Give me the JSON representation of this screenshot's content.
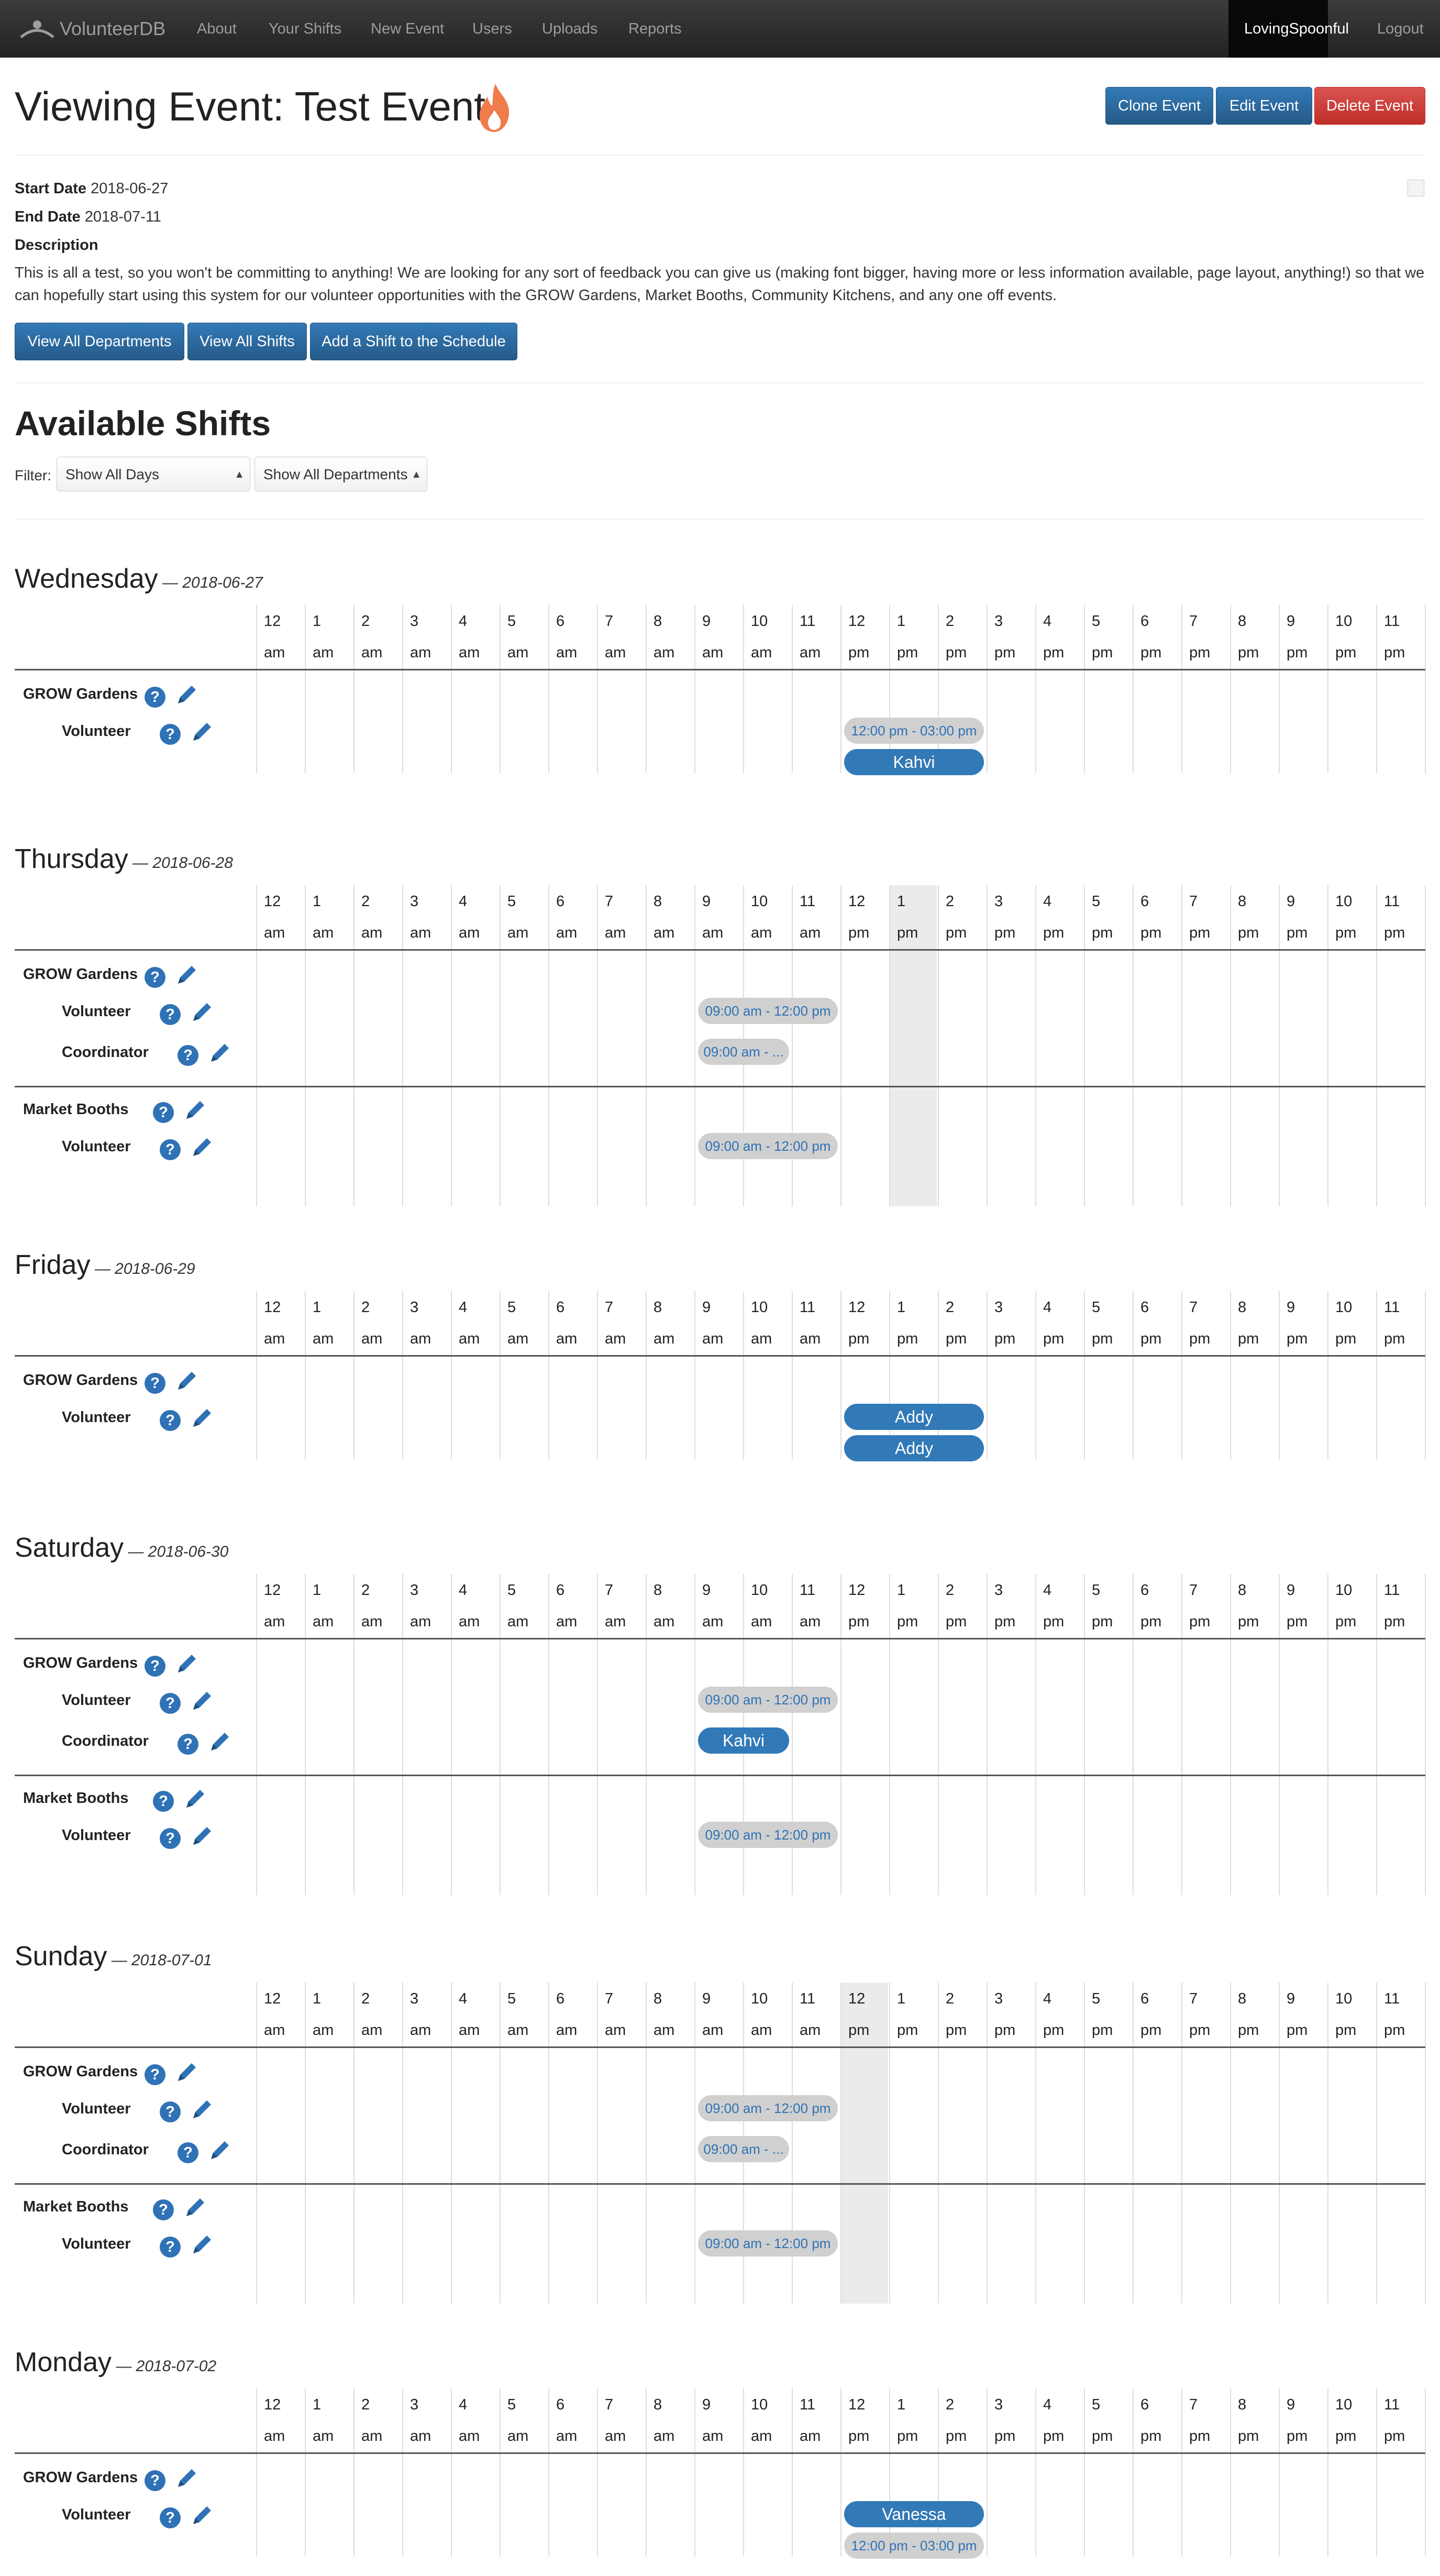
{
  "nav": {
    "brand": "VolunteerDB",
    "links": [
      "About",
      "Your Shifts",
      "New Event",
      "Users",
      "Uploads",
      "Reports"
    ],
    "user": "LovingSpoonful",
    "logout": "Logout"
  },
  "page_title": "Viewing Event: Test Event",
  "actions": {
    "clone": "Clone Event",
    "edit": "Edit Event",
    "delete": "Delete Event"
  },
  "event": {
    "start_label": "Start Date",
    "start_value": "2018-06-27",
    "end_label": "End Date",
    "end_value": "2018-07-11",
    "description_label": "Description",
    "description": "This is all a test, so you won't be committing to anything! We are looking for any sort of feedback you can give us (making font bigger, having more or less information available, page layout, anything!) so that we can hopefully start using this system for our volunteer opportunities with the GROW Gardens, Market Booths, Community Kitchens, and any one off events."
  },
  "event_buttons": {
    "departments": "View All Departments",
    "shifts": "View All Shifts",
    "add_shift": "Add a Shift to the Schedule"
  },
  "shifts_heading": "Available Shifts",
  "filter": {
    "label": "Filter:",
    "days": "Show All Days",
    "departments": "Show All Departments"
  },
  "hours": [
    [
      "12",
      "am"
    ],
    [
      "1",
      "am"
    ],
    [
      "2",
      "am"
    ],
    [
      "3",
      "am"
    ],
    [
      "4",
      "am"
    ],
    [
      "5",
      "am"
    ],
    [
      "6",
      "am"
    ],
    [
      "7",
      "am"
    ],
    [
      "8",
      "am"
    ],
    [
      "9",
      "am"
    ],
    [
      "10",
      "am"
    ],
    [
      "11",
      "am"
    ],
    [
      "12",
      "pm"
    ],
    [
      "1",
      "pm"
    ],
    [
      "2",
      "pm"
    ],
    [
      "3",
      "pm"
    ],
    [
      "4",
      "pm"
    ],
    [
      "5",
      "pm"
    ],
    [
      "6",
      "pm"
    ],
    [
      "7",
      "pm"
    ],
    [
      "8",
      "pm"
    ],
    [
      "9",
      "pm"
    ],
    [
      "10",
      "pm"
    ],
    [
      "11",
      "pm"
    ]
  ],
  "colors": {
    "primary": "#337ab7",
    "danger": "#d9534f",
    "navbar": "#222222",
    "shift_open": "#d0d0d0"
  },
  "days": [
    {
      "name": "Wednesday",
      "date": "— 2018-06-27",
      "highlight": null,
      "departments": [
        {
          "name": "GROW Gardens",
          "roles": [
            {
              "name": "Volunteer",
              "shifts": [
                {
                  "label": "12:00 pm - 03:00 pm",
                  "start": 12,
                  "end": 15,
                  "taken": false
                },
                {
                  "label": "Kahvi",
                  "start": 12,
                  "end": 15,
                  "taken": true
                }
              ]
            }
          ]
        }
      ]
    },
    {
      "name": "Thursday",
      "date": "— 2018-06-28",
      "highlight": 13,
      "departments": [
        {
          "name": "GROW Gardens",
          "roles": [
            {
              "name": "Volunteer",
              "shifts": [
                {
                  "label": "09:00 am - 12:00 pm",
                  "start": 9,
                  "end": 12,
                  "taken": false
                }
              ]
            },
            {
              "name": "Coordinator",
              "shifts": [
                {
                  "label": "09:00 am - ...",
                  "start": 9,
                  "end": 11,
                  "taken": false
                }
              ]
            }
          ]
        },
        {
          "name": "Market Booths",
          "roles": [
            {
              "name": "Volunteer",
              "shifts": [
                {
                  "label": "09:00 am - 12:00 pm",
                  "start": 9,
                  "end": 12,
                  "taken": false
                }
              ]
            }
          ]
        }
      ]
    },
    {
      "name": "Friday",
      "date": "— 2018-06-29",
      "highlight": null,
      "departments": [
        {
          "name": "GROW Gardens",
          "roles": [
            {
              "name": "Volunteer",
              "shifts": [
                {
                  "label": "Addy",
                  "start": 12,
                  "end": 15,
                  "taken": true
                },
                {
                  "label": "Addy",
                  "start": 12,
                  "end": 15,
                  "taken": true
                }
              ]
            }
          ]
        }
      ]
    },
    {
      "name": "Saturday",
      "date": "— 2018-06-30",
      "highlight": null,
      "departments": [
        {
          "name": "GROW Gardens",
          "roles": [
            {
              "name": "Volunteer",
              "shifts": [
                {
                  "label": "09:00 am - 12:00 pm",
                  "start": 9,
                  "end": 12,
                  "taken": false
                }
              ]
            },
            {
              "name": "Coordinator",
              "shifts": [
                {
                  "label": "Kahvi",
                  "start": 9,
                  "end": 11,
                  "taken": true
                }
              ]
            }
          ]
        },
        {
          "name": "Market Booths",
          "roles": [
            {
              "name": "Volunteer",
              "shifts": [
                {
                  "label": "09:00 am - 12:00 pm",
                  "start": 9,
                  "end": 12,
                  "taken": false
                }
              ]
            }
          ]
        }
      ]
    },
    {
      "name": "Sunday",
      "date": "— 2018-07-01",
      "highlight": 12,
      "departments": [
        {
          "name": "GROW Gardens",
          "roles": [
            {
              "name": "Volunteer",
              "shifts": [
                {
                  "label": "09:00 am - 12:00 pm",
                  "start": 9,
                  "end": 12,
                  "taken": false
                }
              ]
            },
            {
              "name": "Coordinator",
              "shifts": [
                {
                  "label": "09:00 am - ...",
                  "start": 9,
                  "end": 11,
                  "taken": false
                }
              ]
            }
          ]
        },
        {
          "name": "Market Booths",
          "roles": [
            {
              "name": "Volunteer",
              "shifts": [
                {
                  "label": "09:00 am - 12:00 pm",
                  "start": 9,
                  "end": 12,
                  "taken": false
                }
              ]
            }
          ]
        }
      ]
    },
    {
      "name": "Monday",
      "date": "— 2018-07-02",
      "highlight": null,
      "departments": [
        {
          "name": "GROW Gardens",
          "roles": [
            {
              "name": "Volunteer",
              "shifts": [
                {
                  "label": "Vanessa",
                  "start": 12,
                  "end": 15,
                  "taken": true
                },
                {
                  "label": "12:00 pm - 03:00 pm",
                  "start": 12,
                  "end": 15,
                  "taken": false
                }
              ]
            }
          ]
        }
      ]
    }
  ]
}
